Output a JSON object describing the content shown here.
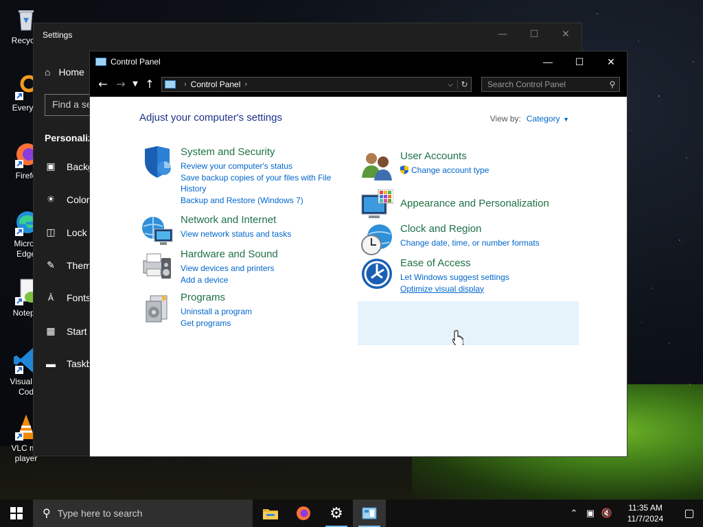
{
  "desktop": {
    "icons": [
      {
        "label": "Recycle",
        "icon": "recycle-bin-icon"
      },
      {
        "label": "Everyth",
        "icon": "everything-search-icon"
      },
      {
        "label": "Firefo",
        "icon": "firefox-icon"
      },
      {
        "label": "Micros\nEdge",
        "icon": "edge-icon"
      },
      {
        "label": "Notepa",
        "icon": "notepad-plus-icon"
      },
      {
        "label": "Visual St\nCod",
        "icon": "vscode-icon"
      },
      {
        "label": "VLC me\nplayer",
        "icon": "vlc-icon"
      }
    ]
  },
  "settings_window": {
    "title": "Settings",
    "home": "Home",
    "find_placeholder": "Find a se",
    "section": "Personaliz",
    "nav": [
      {
        "label": "Backg",
        "icon": "image-icon"
      },
      {
        "label": "Color",
        "icon": "palette-icon"
      },
      {
        "label": "Lock s",
        "icon": "lock-screen-icon"
      },
      {
        "label": "Them",
        "icon": "theme-brush-icon"
      },
      {
        "label": "Fonts",
        "icon": "font-icon"
      },
      {
        "label": "Start",
        "icon": "start-tiles-icon"
      },
      {
        "label": "Taskb",
        "icon": "taskbar-icon"
      }
    ]
  },
  "control_panel": {
    "window_title": "Control Panel",
    "breadcrumb": "Control Panel",
    "search_placeholder": "Search Control Panel",
    "heading": "Adjust your computer's settings",
    "view_by_label": "View by:",
    "view_by_value": "Category",
    "categories_left": [
      {
        "title": "System and Security",
        "icon": "shield-icon",
        "links": [
          "Review your computer's status",
          "Save backup copies of your files with File History",
          "Backup and Restore (Windows 7)"
        ]
      },
      {
        "title": "Network and Internet",
        "icon": "globe-network-icon",
        "links": [
          "View network status and tasks"
        ]
      },
      {
        "title": "Hardware and Sound",
        "icon": "printer-speaker-icon",
        "links": [
          "View devices and printers",
          "Add a device"
        ]
      },
      {
        "title": "Programs",
        "icon": "programs-icon",
        "links": [
          "Uninstall a program",
          "Get programs"
        ]
      }
    ],
    "categories_right": [
      {
        "title": "User Accounts",
        "icon": "users-icon",
        "links": [
          "Change account type"
        ]
      },
      {
        "title": "Appearance and Personalization",
        "icon": "monitor-colors-icon",
        "links": []
      },
      {
        "title": "Clock and Region",
        "icon": "clock-globe-icon",
        "links": [
          "Change date, time, or number formats"
        ]
      },
      {
        "title": "Ease of Access",
        "icon": "ease-of-access-icon",
        "links": [
          "Let Windows suggest settings",
          "Optimize visual display"
        ]
      }
    ]
  },
  "taskbar": {
    "search_placeholder": "Type here to search",
    "apps": [
      "file-explorer-icon",
      "firefox-icon",
      "settings-gear-icon",
      "control-panel-icon"
    ],
    "time": "11:35 AM",
    "date": "11/7/2024"
  },
  "colors": {
    "category_title": "#1e7145",
    "link": "#0066cc",
    "heading": "#1e3287",
    "highlight": "#e5f3fb"
  }
}
